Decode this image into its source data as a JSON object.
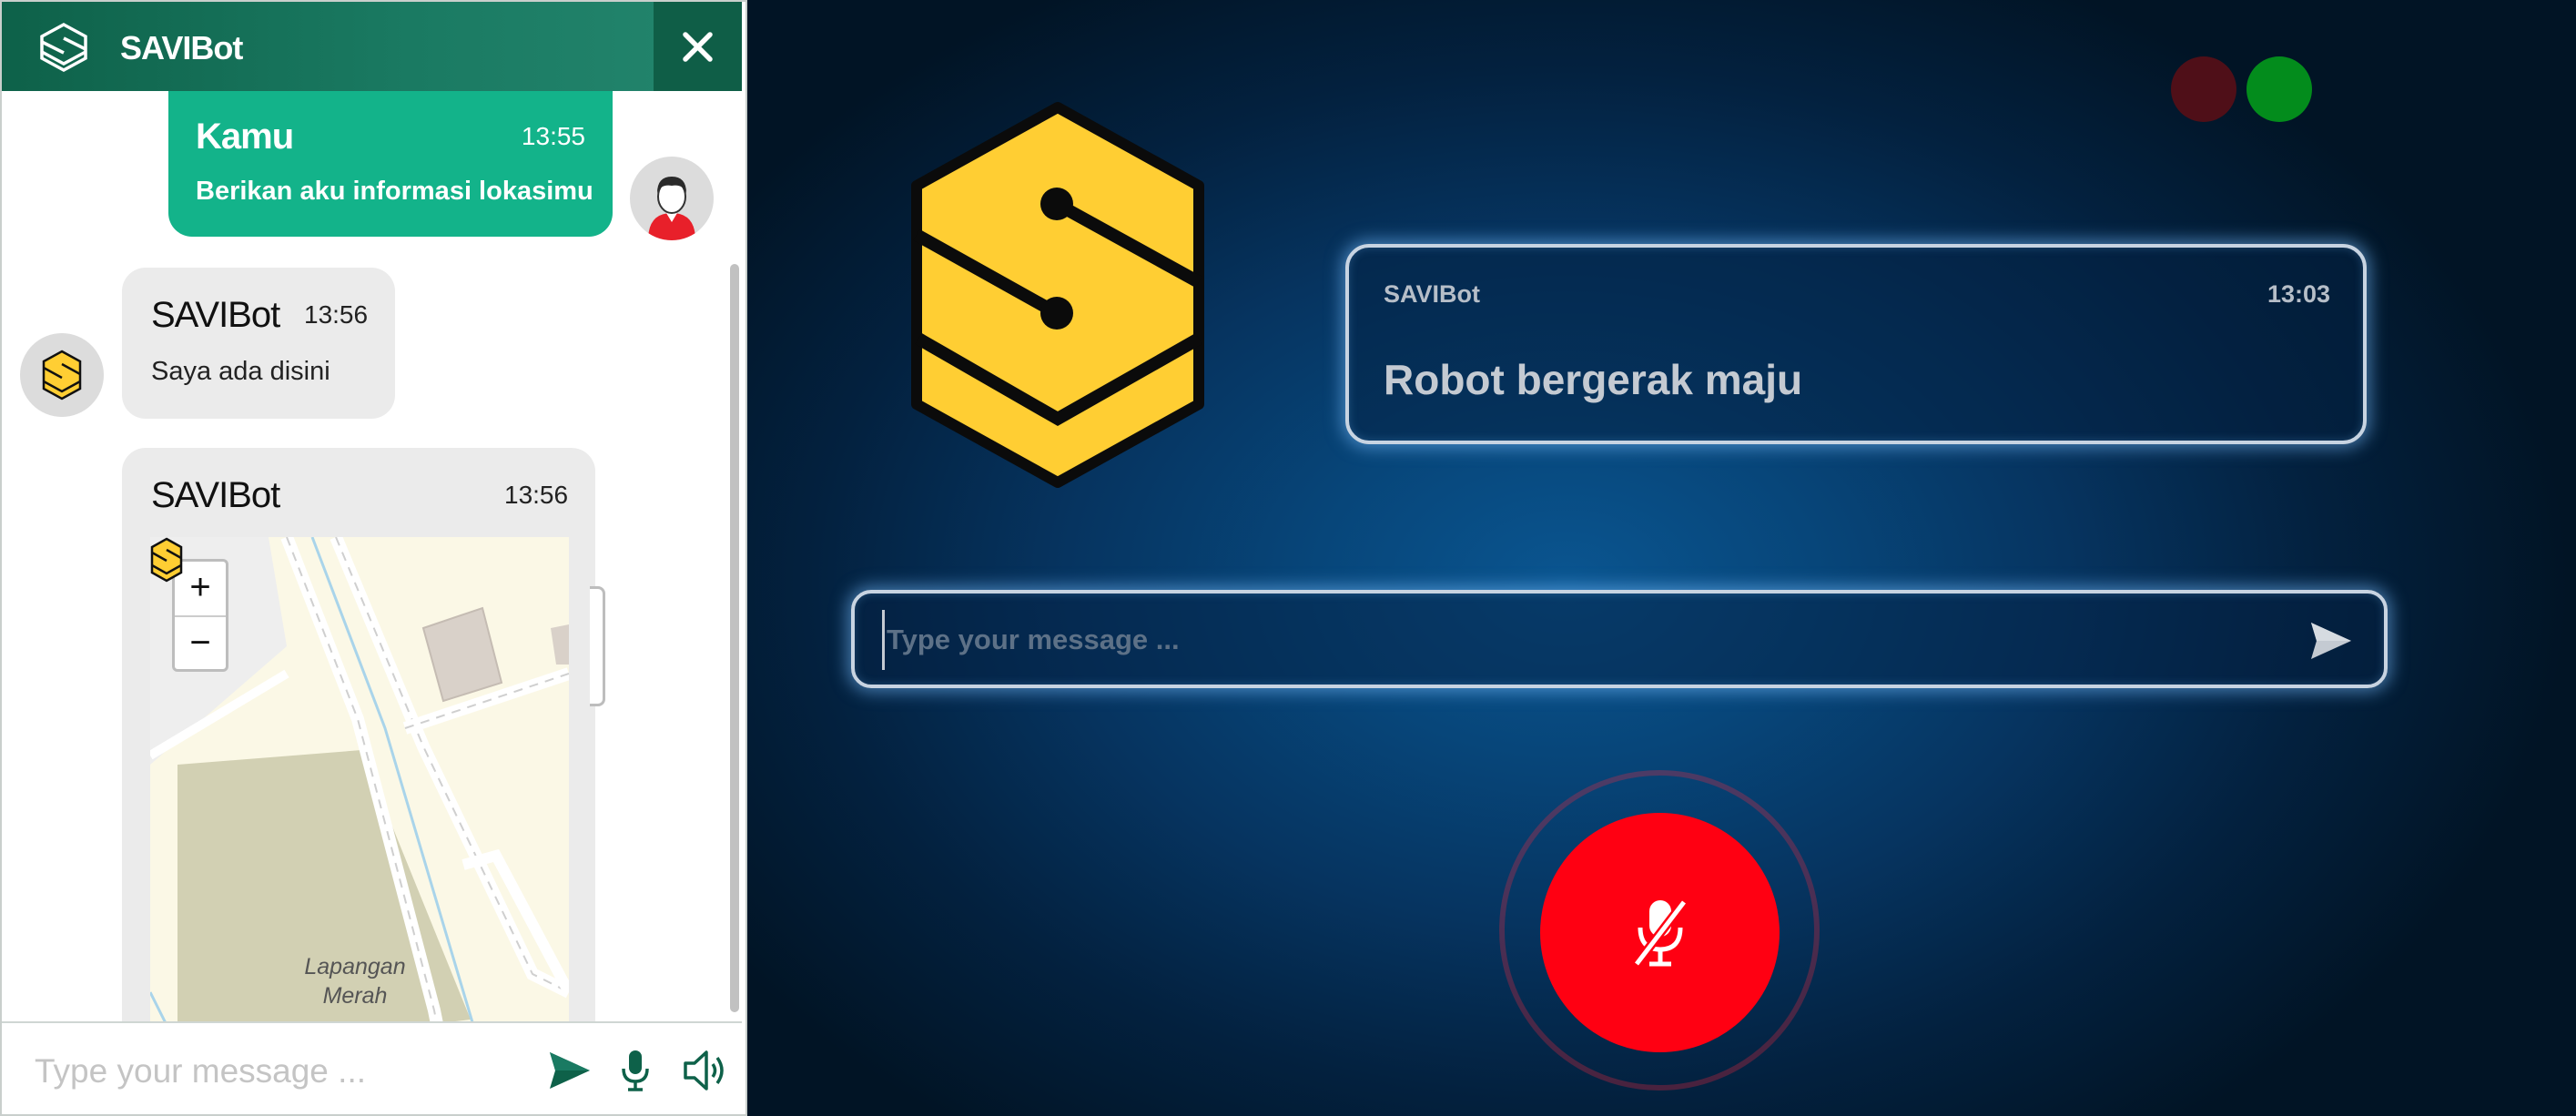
{
  "widget": {
    "title": "SAVIBot",
    "messages": [
      {
        "sender": "Kamu",
        "time": "13:55",
        "text": "Berikan aku informasi lokasimu"
      },
      {
        "sender": "SAVIBot",
        "time": "13:56",
        "text": "Saya ada disini"
      },
      {
        "sender": "SAVIBot",
        "time": "13:56",
        "map": {
          "place_label": "Lapangan Merah",
          "zoom_in": "+",
          "zoom_out": "−"
        }
      }
    ],
    "input_placeholder": "Type your message ..."
  },
  "stage": {
    "status": [
      {
        "name": "inactive",
        "color": "#4f0f18"
      },
      {
        "name": "active",
        "color": "#038c1c"
      }
    ],
    "last_message": {
      "sender": "SAVIBot",
      "time": "13:03",
      "text": "Robot bergerak maju"
    },
    "input_placeholder": "Type your message ...",
    "mic_state": "muted"
  },
  "colors": {
    "accent": "#13b38a",
    "header": "#0e6149",
    "logo": "#ffce33",
    "mic": "#ff0012"
  }
}
